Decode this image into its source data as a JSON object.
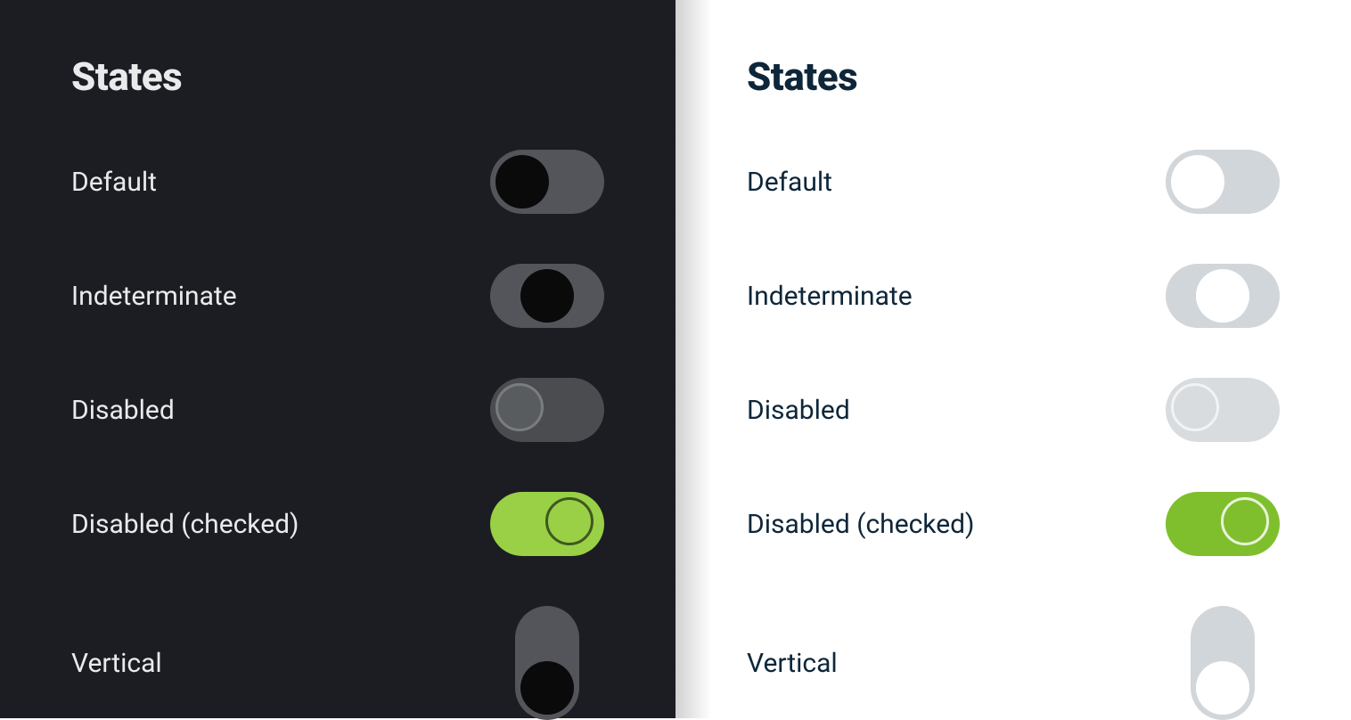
{
  "heading": "States",
  "rows": {
    "default": {
      "label": "Default"
    },
    "indeterminate": {
      "label": "Indeterminate"
    },
    "disabled": {
      "label": "Disabled"
    },
    "disabled_checked": {
      "label": "Disabled (checked)"
    },
    "vertical": {
      "label": "Vertical"
    }
  },
  "colors": {
    "dark_bg": "#1b1d22",
    "dark_track": "#53555a",
    "dark_thumb": "#0a0a0a",
    "light_bg": "#ffffff",
    "light_track": "#d1d6da",
    "light_thumb": "#ffffff",
    "accent_green_dark": "#99d046",
    "accent_green_light": "#7fbf2e",
    "text_dark": "#e9eaec",
    "text_light": "#0e2639"
  }
}
